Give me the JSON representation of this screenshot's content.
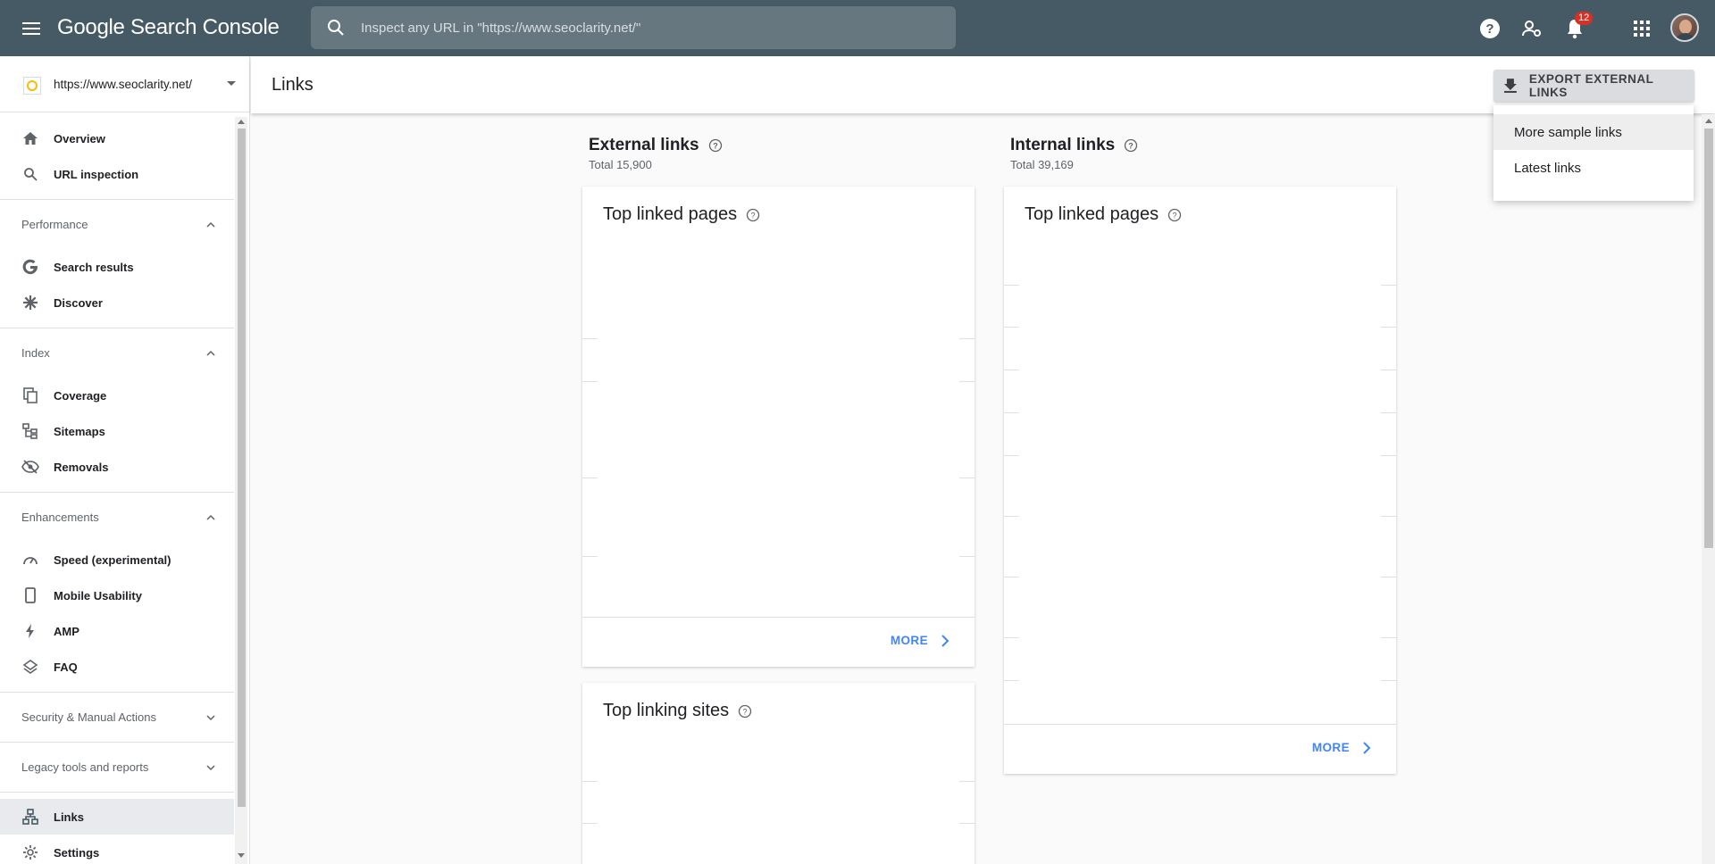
{
  "app": {
    "logo_google": "Google",
    "logo_product": "Search Console",
    "search_placeholder": "Inspect any URL in \"https://www.seoclarity.net/\"",
    "notification_count": "12"
  },
  "sidebar": {
    "property_url": "https://www.seoclarity.net/",
    "top_items": [
      {
        "label": "Overview",
        "icon": "home-icon"
      },
      {
        "label": "URL inspection",
        "icon": "search-icon"
      }
    ],
    "sections": [
      {
        "label": "Performance",
        "items": [
          {
            "label": "Search results",
            "icon": "google-g-icon"
          },
          {
            "label": "Discover",
            "icon": "asterisk-icon"
          }
        ]
      },
      {
        "label": "Index",
        "items": [
          {
            "label": "Coverage",
            "icon": "coverage-icon"
          },
          {
            "label": "Sitemaps",
            "icon": "sitemaps-icon"
          },
          {
            "label": "Removals",
            "icon": "eye-off-icon"
          }
        ]
      },
      {
        "label": "Enhancements",
        "items": [
          {
            "label": "Speed (experimental)",
            "icon": "speedometer-icon"
          },
          {
            "label": "Mobile Usability",
            "icon": "phone-icon"
          },
          {
            "label": "AMP",
            "icon": "lightning-icon"
          },
          {
            "label": "FAQ",
            "icon": "layers-icon"
          }
        ]
      },
      {
        "label": "Security & Manual Actions"
      },
      {
        "label": "Legacy tools and reports"
      }
    ],
    "bottom_items": [
      {
        "label": "Links",
        "icon": "links-icon"
      },
      {
        "label": "Settings",
        "icon": "gear-icon"
      }
    ]
  },
  "header": {
    "title": "Links",
    "export_label": "EXPORT EXTERNAL LINKS"
  },
  "menu": {
    "items": [
      "More sample links",
      "Latest links"
    ]
  },
  "external": {
    "title": "External links",
    "total": "Total 15,900",
    "card1_title": "Top linked pages",
    "card1_more": "MORE",
    "card2_title": "Top linking sites"
  },
  "internal": {
    "title": "Internal links",
    "total": "Total 39,169",
    "card_title": "Top linked pages",
    "card_more": "MORE"
  },
  "colors": {
    "topbar": "#455a64",
    "accent": "#4285f4",
    "badge": "#d93025"
  }
}
